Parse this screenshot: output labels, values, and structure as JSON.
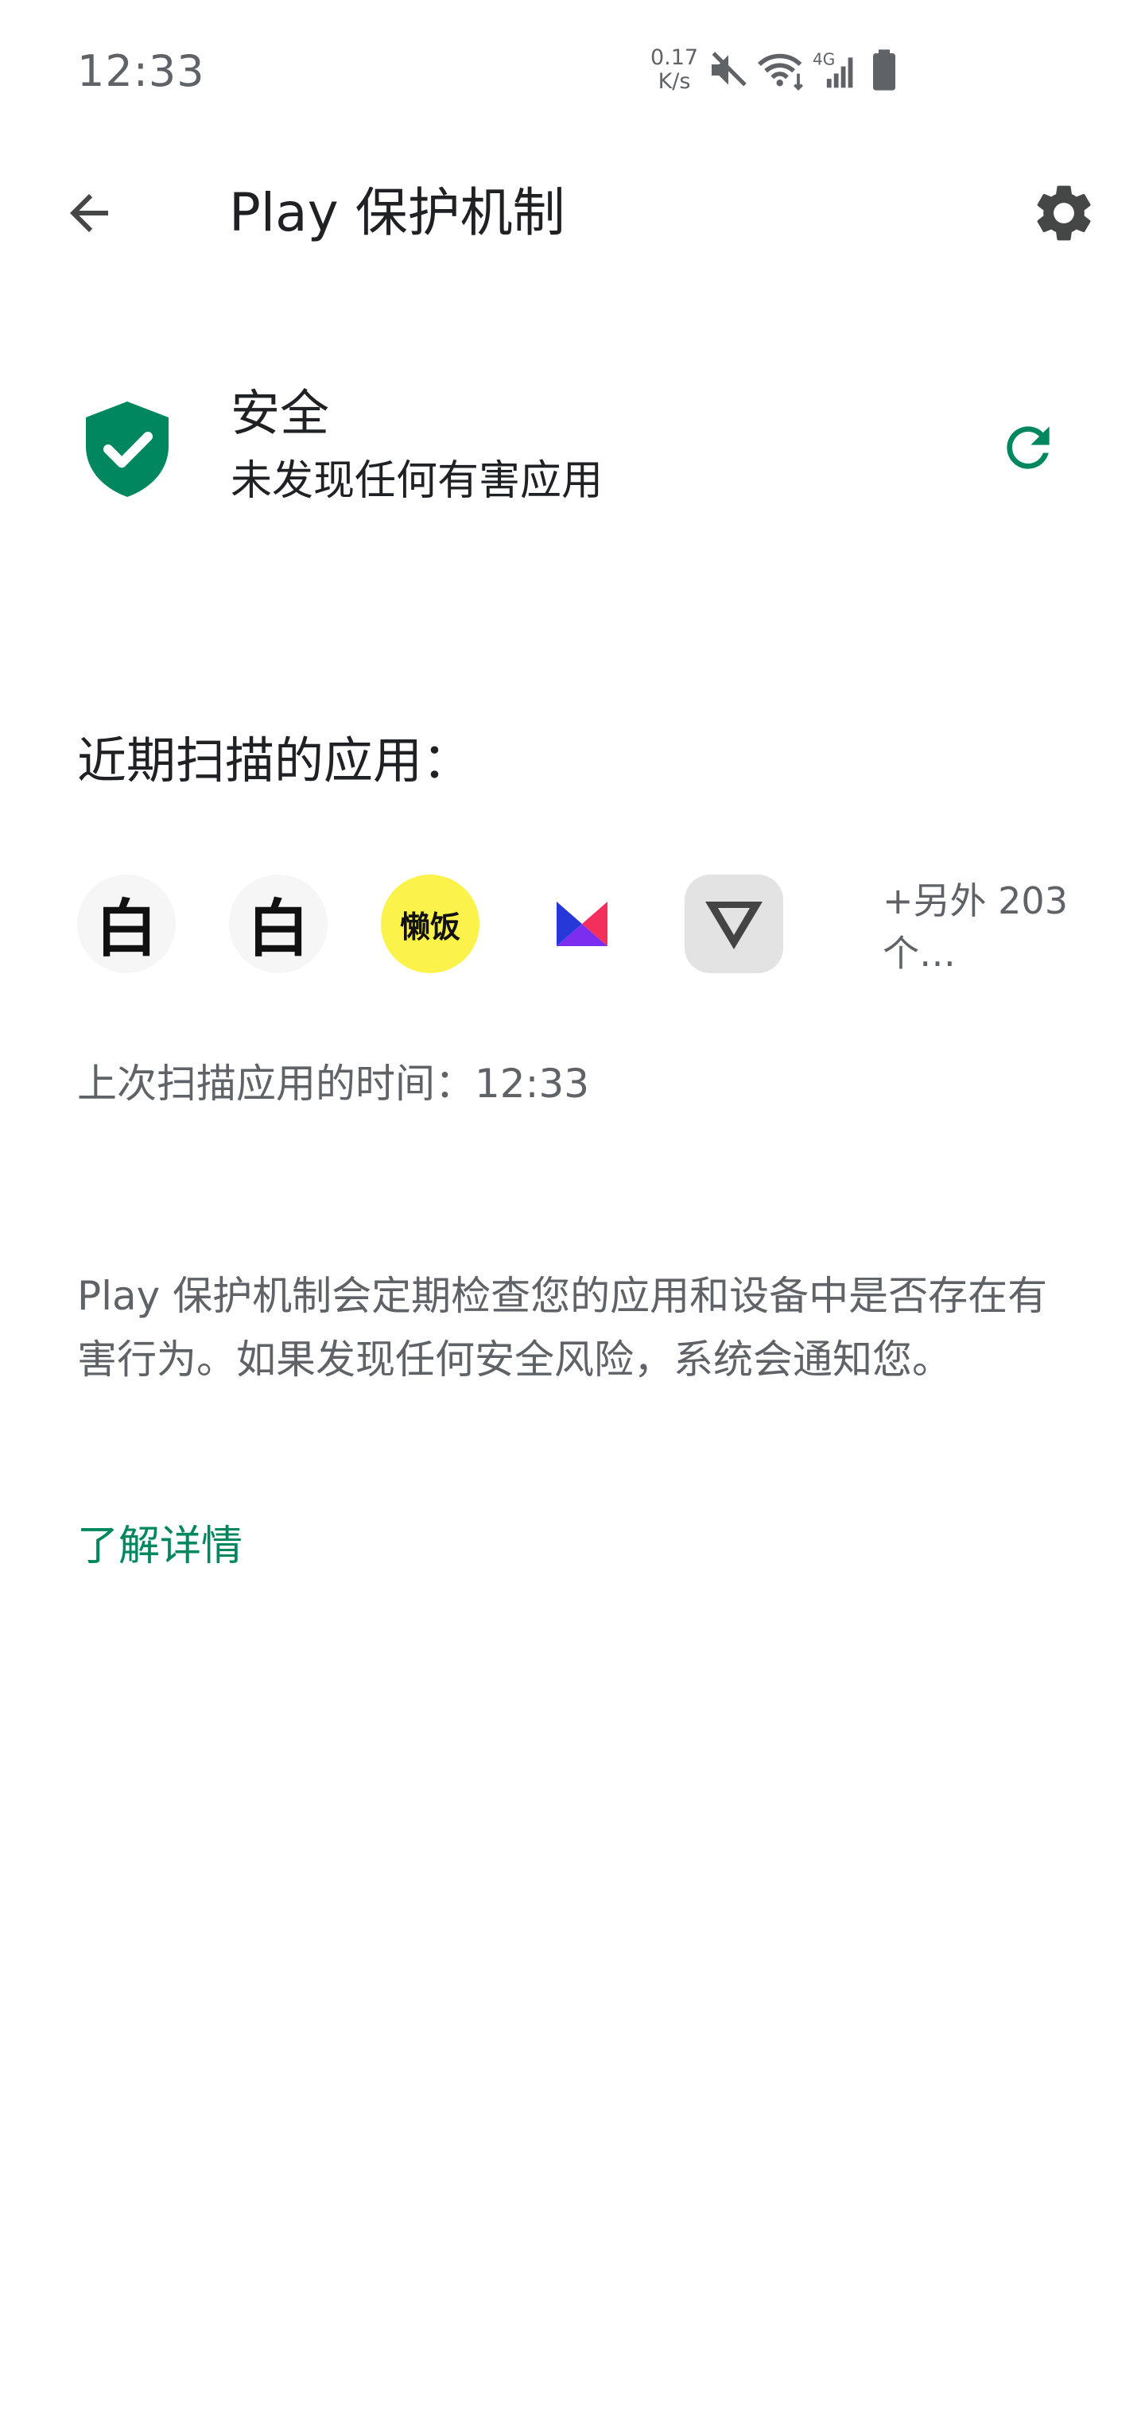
{
  "status_bar": {
    "time": "12:33",
    "net_speed_value": "0.17",
    "net_speed_unit": "K/s",
    "network": "4G",
    "icons": [
      "mute-icon",
      "wifi-icon",
      "cellular-signal-icon",
      "battery-icon"
    ]
  },
  "app_bar": {
    "title": "Play 保护机制",
    "back_icon": "arrow-back-icon",
    "settings_icon": "gear-icon"
  },
  "status": {
    "title": "安全",
    "subtitle": "未发现任何有害应用",
    "icon": "shield-check-icon",
    "refresh_icon": "refresh-icon",
    "accent_color": "#01875f"
  },
  "recent": {
    "heading": "近期扫描的应用：",
    "apps": [
      {
        "label": "白",
        "icon": "bai-app-icon"
      },
      {
        "label": "白",
        "icon": "bai-app-icon"
      },
      {
        "label": "懒饭",
        "icon": "lanfan-app-icon",
        "color": "#fbf34a"
      },
      {
        "label": "",
        "icon": "k-app-icon"
      },
      {
        "label": "",
        "icon": "v-app-icon"
      }
    ],
    "more": "+另外 203 个…"
  },
  "last_scan": "上次扫描应用的时间：12:33",
  "description": "Play 保护机制会定期检查您的应用和设备中是否存在有害行为。如果发现任何安全风险，系统会通知您。",
  "learn_more": "了解详情"
}
